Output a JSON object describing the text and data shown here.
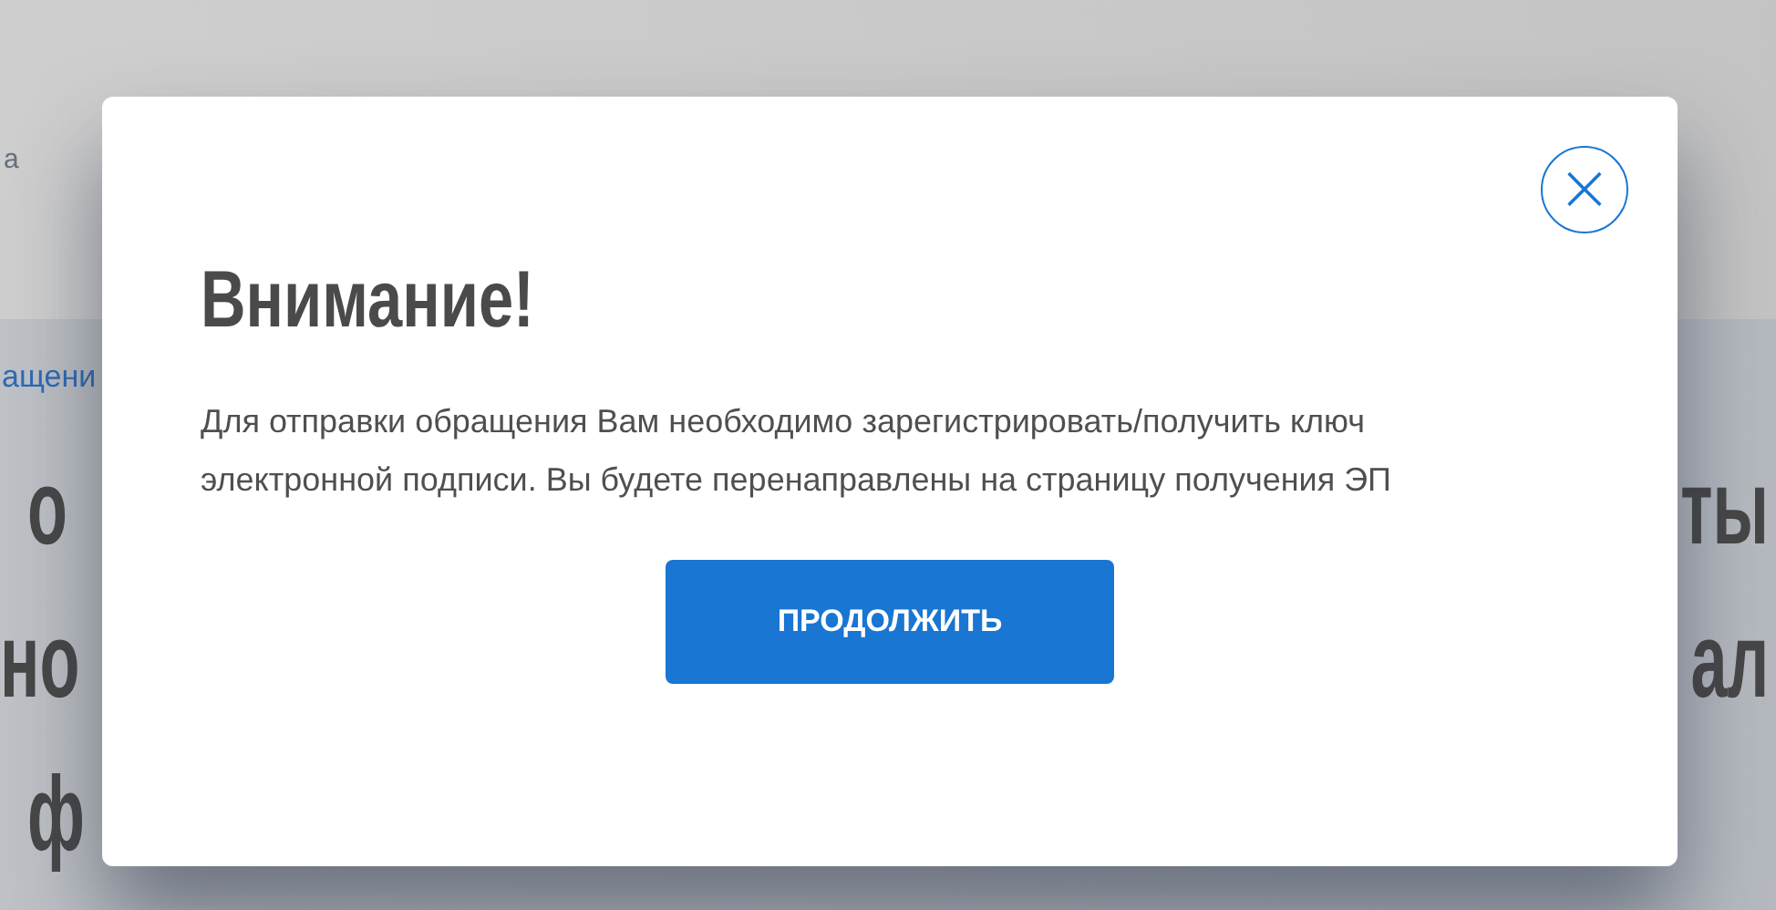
{
  "background": {
    "header_text": "а",
    "link": "ащени",
    "heading_lines": [
      {
        "left": "о",
        "right": "ты"
      },
      {
        "left": "но",
        "right": "ал"
      },
      {
        "left": "ф"
      }
    ]
  },
  "dialog": {
    "close": "×",
    "title": "Внимание!",
    "message": "Для отправки обращения Вам необходимо зарегистрировать/получить ключ электронной подписи. Вы будете перенаправлены на страницу получения ЭП",
    "button": "ПРОДОЛЖИТЬ"
  }
}
